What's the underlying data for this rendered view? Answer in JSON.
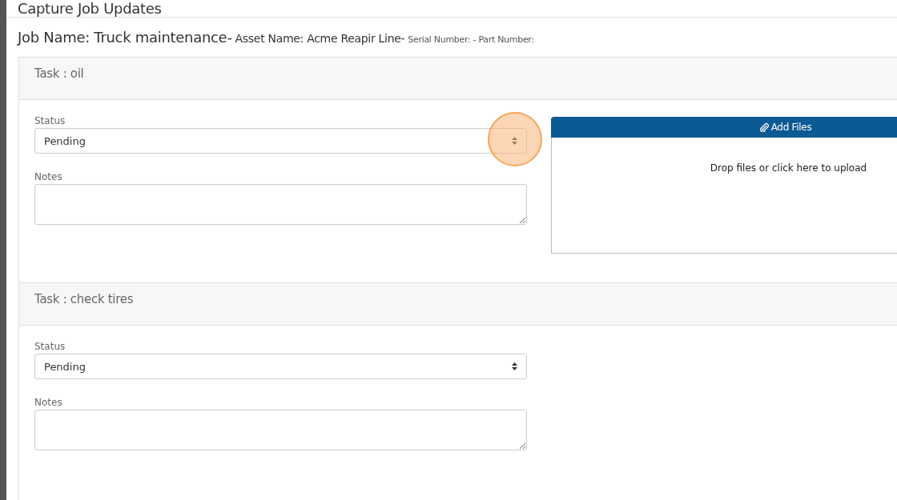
{
  "window": {
    "title": "Capture Job Updates"
  },
  "job_info": [
    {
      "text": "Job Name: Truck maintenance-",
      "kind": "job"
    },
    {
      "text": "Asset Name: Acme Reapir Line-",
      "kind": "asset"
    },
    {
      "text": "Serial Number: - Part Number:",
      "kind": "ids"
    }
  ],
  "tasks": [
    {
      "title": "Task : oil",
      "status_label": "Status",
      "status": "Pending",
      "notes_label": "Notes",
      "click_marker": true,
      "upload": {
        "button": "Add Files",
        "hint": "Drop files or click here to upload"
      }
    },
    {
      "title": "Task : check tires",
      "status_label": "Status",
      "status": "Pending",
      "notes_label": "Notes",
      "click_marker": false
    }
  ]
}
